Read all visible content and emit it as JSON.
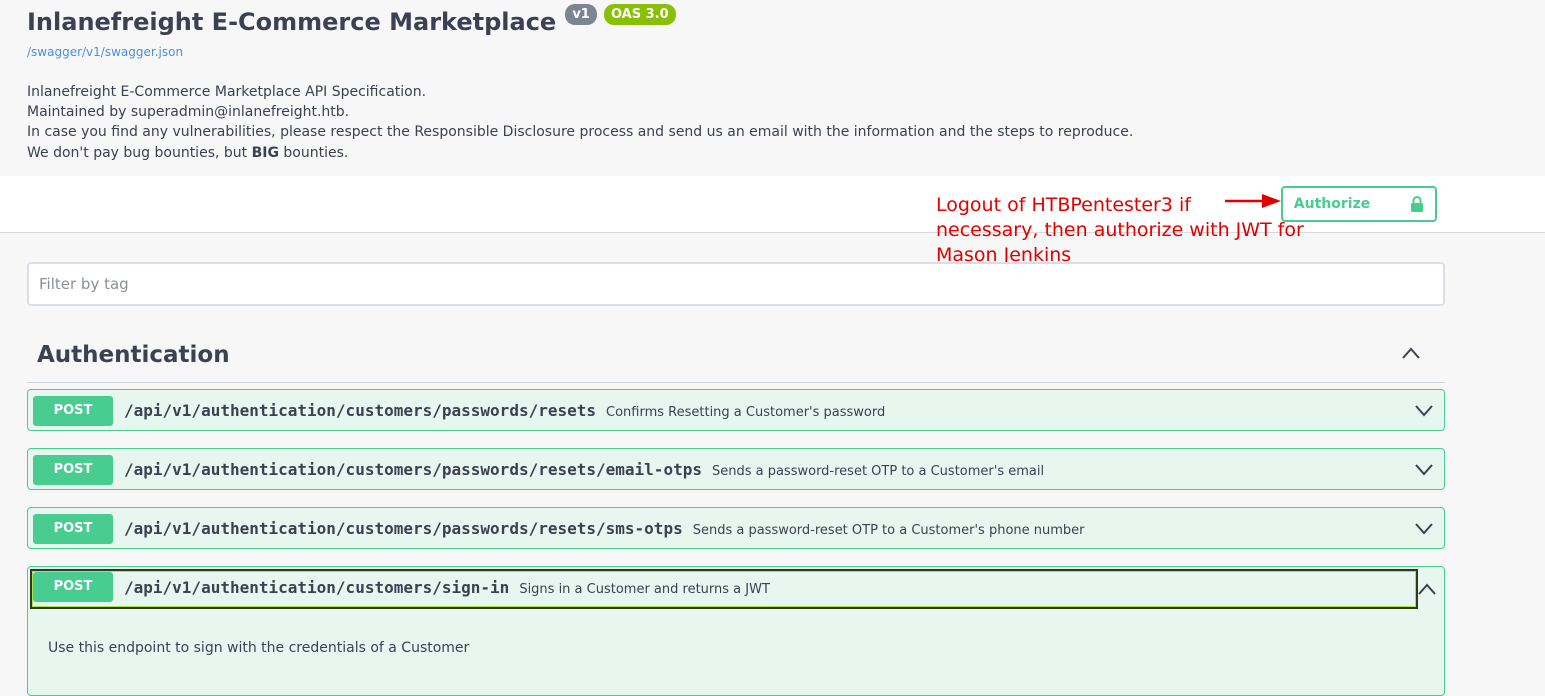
{
  "info": {
    "title": "Inlanefreight E-Commerce Marketplace",
    "version_badge": "v1",
    "oas_badge": "OAS 3.0",
    "spec_link": "/swagger/v1/swagger.json",
    "description_lines": [
      "Inlanefreight E-Commerce Marketplace API Specification.",
      "Maintained by superadmin@inlanefreight.htb.",
      "In case you find any vulnerabilities, please respect the Responsible Disclosure process and send us an email with the information and the steps to reproduce."
    ],
    "bounty_line": {
      "prefix": "We don't pay bug bounties, but ",
      "bold": "BIG",
      "suffix": " bounties."
    }
  },
  "authorize": {
    "label": "Authorize",
    "icon": "lock-icon",
    "color": "#49cc90"
  },
  "annotation": {
    "lines": [
      "Logout of HTBPentester3 if",
      "necessary, then authorize with JWT for",
      "Mason Jenkins"
    ],
    "color": "#e00000"
  },
  "filter": {
    "placeholder": "Filter by tag",
    "value": ""
  },
  "tag": {
    "name": "Authentication",
    "state_icon": "chevron-up-icon"
  },
  "operations": [
    {
      "method": "POST",
      "path": "/api/v1/authentication/customers/passwords/resets",
      "summary": "Confirms Resetting a Customer's password",
      "icon": "chevron-down-icon"
    },
    {
      "method": "POST",
      "path": "/api/v1/authentication/customers/passwords/resets/email-otps",
      "summary": "Sends a password-reset OTP to a Customer's email",
      "icon": "chevron-down-icon"
    },
    {
      "method": "POST",
      "path": "/api/v1/authentication/customers/passwords/resets/sms-otps",
      "summary": "Sends a password-reset OTP to a Customer's phone number",
      "icon": "chevron-down-icon"
    },
    {
      "method": "POST",
      "path": "/api/v1/authentication/customers/sign-in",
      "summary": "Signs in a Customer and returns a JWT",
      "icon": "chevron-up-icon",
      "expanded": true,
      "description": "Use this endpoint to sign with the credentials of a Customer"
    }
  ],
  "colors": {
    "post": "#49cc90",
    "post_bg": "#e8f6f0",
    "link": "#4990e2",
    "text": "#3b4151"
  }
}
